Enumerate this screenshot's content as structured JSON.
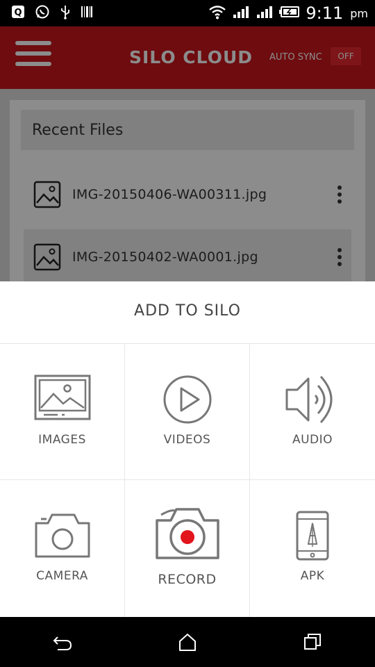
{
  "status_bar": {
    "time": "9:11",
    "ampm": "pm",
    "icons": [
      "q-app-icon",
      "whatsapp-icon",
      "usb-icon",
      "barcode-icon",
      "wifi-icon",
      "signal-icon",
      "signal-icon-2",
      "battery-icon"
    ]
  },
  "app_bar": {
    "title": "SILO CLOUD",
    "auto_sync_label": "AUTO SYNC",
    "auto_sync_state": "OFF"
  },
  "recent_files": {
    "header": "Recent Files",
    "items": [
      {
        "name": "IMG-20150406-WA00311.jpg"
      },
      {
        "name": "IMG-20150402-WA0001.jpg"
      }
    ]
  },
  "sheet": {
    "title": "ADD TO SILO",
    "options": [
      {
        "label": "IMAGES",
        "icon": "images-icon"
      },
      {
        "label": "VIDEOS",
        "icon": "video-play-icon"
      },
      {
        "label": "AUDIO",
        "icon": "speaker-icon"
      },
      {
        "label": "CAMERA",
        "icon": "camera-icon"
      },
      {
        "label": "RECORD",
        "icon": "record-camera-icon"
      },
      {
        "label": "APK",
        "icon": "apk-phone-icon"
      }
    ]
  },
  "colors": {
    "brand_red": "#c8161d",
    "record_dot": "#e2141c"
  }
}
